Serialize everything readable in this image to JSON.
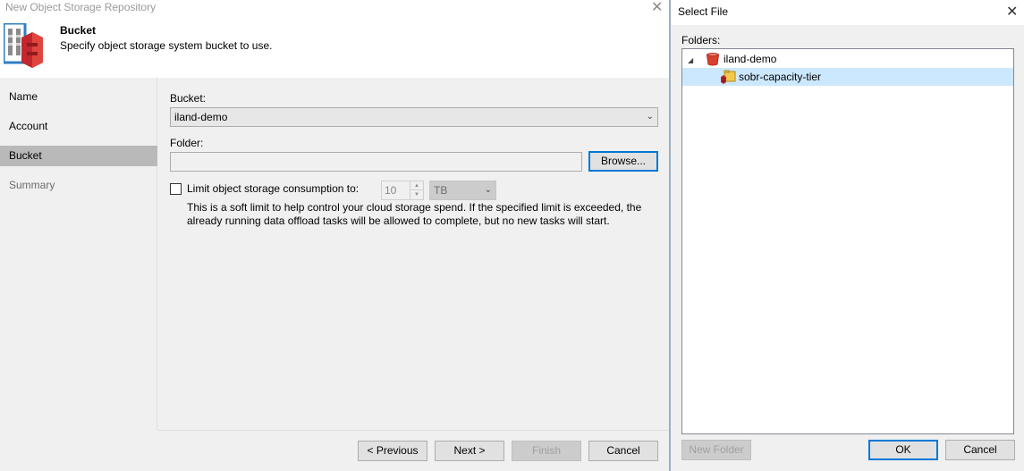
{
  "wizard": {
    "window_title": "New Object Storage Repository",
    "header": {
      "title": "Bucket",
      "subtitle": "Specify object storage system bucket to use."
    },
    "nav": [
      {
        "label": "Name",
        "state": "done"
      },
      {
        "label": "Account",
        "state": "done"
      },
      {
        "label": "Bucket",
        "state": "active"
      },
      {
        "label": "Summary",
        "state": "disabled"
      }
    ],
    "form": {
      "bucket_label": "Bucket:",
      "bucket_value": "iland-demo",
      "folder_label": "Folder:",
      "folder_value": "",
      "browse_label": "Browse...",
      "limit_label": "Limit object storage consumption to:",
      "limit_checked": false,
      "limit_value": "10",
      "limit_unit": "TB",
      "hint": "This is a soft limit to help control your cloud storage spend. If the specified limit is exceeded, the already running data offload tasks will be allowed to complete, but no new tasks will start."
    },
    "footer": {
      "previous": "< Previous",
      "next": "Next >",
      "finish": "Finish",
      "cancel": "Cancel"
    }
  },
  "select_file": {
    "title": "Select File",
    "folders_label": "Folders:",
    "tree": {
      "root": "iland-demo",
      "child": "sobr-capacity-tier"
    },
    "new_folder": "New Folder",
    "ok": "OK",
    "cancel": "Cancel"
  },
  "colors": {
    "selection": "#cce8ff",
    "active_nav": "#b9b9b9",
    "focus_border": "#0078d7",
    "bucket_red": "#d9402f"
  }
}
